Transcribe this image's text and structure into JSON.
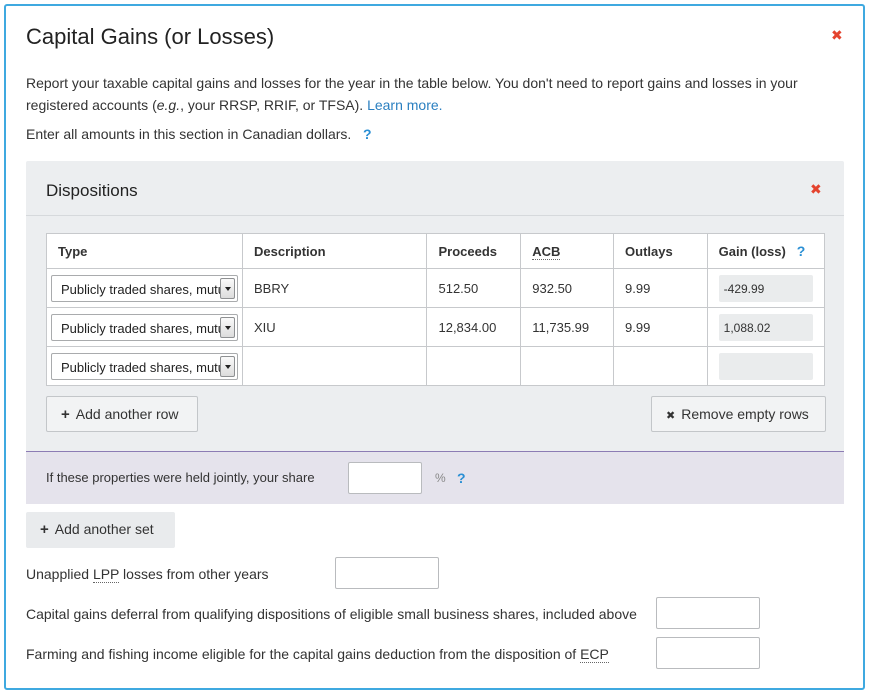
{
  "dialog": {
    "title": "Capital Gains (or Losses)",
    "close_glyph": "✖"
  },
  "intro": {
    "text_before": "Report your taxable capital gains and losses for the year in the table below. You don't need to report gains and losses in your registered accounts (",
    "eg": "e.g.",
    "text_after": ", your RRSP, RRIF, or TFSA). ",
    "learn_more": "Learn more."
  },
  "note": {
    "text": "Enter all amounts in this section in Canadian dollars.",
    "help": "?"
  },
  "dispositions": {
    "title": "Dispositions",
    "close_glyph": "✖",
    "columns": {
      "type": "Type",
      "description": "Description",
      "proceeds": "Proceeds",
      "acb": "ACB",
      "outlays": "Outlays",
      "gain": "Gain (loss)",
      "gain_help": "?"
    },
    "rows": [
      {
        "type": "Publicly traded shares, mutual fund units",
        "description": "BBRY",
        "proceeds": "512.50",
        "acb": "932.50",
        "outlays": "9.99",
        "gain": "-429.99"
      },
      {
        "type": "Publicly traded shares, mutual fund units",
        "description": "XIU",
        "proceeds": "12,834.00",
        "acb": "11,735.99",
        "outlays": "9.99",
        "gain": "1,088.02"
      },
      {
        "type": "Publicly traded shares, mutual fund units",
        "description": "",
        "proceeds": "",
        "acb": "",
        "outlays": "",
        "gain": ""
      }
    ],
    "add_row": {
      "icon": "+",
      "label": "Add another row"
    },
    "remove_empty": {
      "icon": "✖",
      "label": "Remove empty rows"
    },
    "joint": {
      "label": "If these properties were held jointly, your share",
      "value": "",
      "unit": "%",
      "help": "?"
    }
  },
  "add_set": {
    "icon": "+",
    "label": "Add another set"
  },
  "fields": {
    "lpp_prefix": "Unapplied ",
    "lpp_abbr": "LPP",
    "lpp_suffix": " losses from other years",
    "lpp_value": "",
    "deferral_label": "Capital gains deferral from qualifying dispositions of eligible small business shares, included above",
    "deferral_value": "",
    "farming_prefix": "Farming and fishing income eligible for the capital gains deduction from the disposition of ",
    "farming_abbr": "ECP",
    "farming_value": ""
  },
  "colors": {
    "border_accent": "#3fa9e0",
    "close_red": "#e4432e",
    "link_blue": "#2a7fc0",
    "help_blue": "#2a8fd4",
    "joint_bg": "#e5e3ec"
  }
}
